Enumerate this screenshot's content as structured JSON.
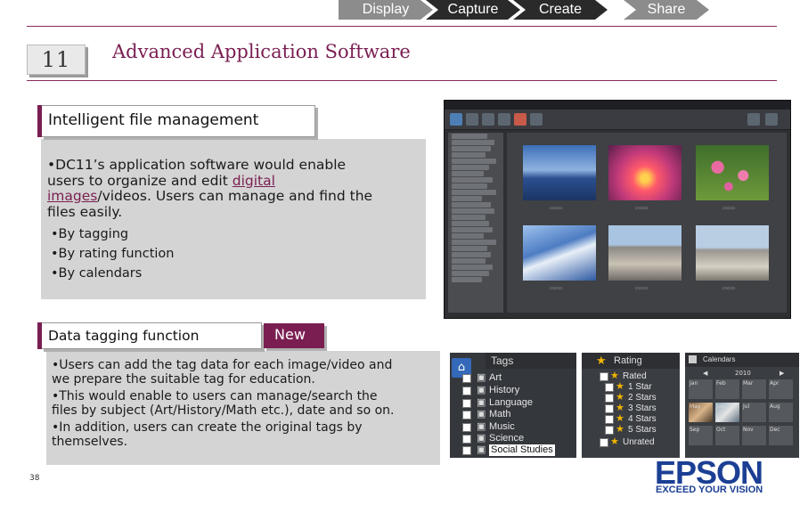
{
  "nav_steps": [
    "Display",
    "Capture",
    "Create",
    "Share"
  ],
  "chapter": {
    "number": "11",
    "title": "Advanced Application Software"
  },
  "section1": {
    "label": "Intelligent file management",
    "lines": [
      "•DC11’s application software would enable",
      "users to organize and edit "
    ],
    "link1": "digital",
    "link2": "images",
    "line_after_link": "/videos. Users can manage and find the",
    "last_line": "files easily.",
    "bullets": [
      "•By tagging",
      "•By rating function",
      "•By calendars"
    ]
  },
  "section2": {
    "label": "Data tagging function",
    "badge": "New",
    "para1": [
      "•Users can add the tag data for each image/video and",
      "we prepare the suitable tag for education."
    ],
    "para2": [
      "•This would enable to users can manage/search the",
      "files by subject (Art/History/Math etc.), date and so on."
    ],
    "para3": [
      "•In addition, users can create the original tags by",
      "themselves."
    ]
  },
  "tags_panel": {
    "title": "Tags",
    "items": [
      "Art",
      "History",
      "Language",
      "Math",
      "Music",
      "Science",
      "Social Studies"
    ]
  },
  "rating_panel": {
    "title": "Rating",
    "items": [
      "Rated",
      "1 Star",
      "2 Stars",
      "3 Stars",
      "4 Stars",
      "5 Stars",
      "Unrated"
    ]
  },
  "calendar_panel": {
    "title": "Calendars",
    "year": "2010",
    "months": [
      "Jan",
      "Feb",
      "Mar",
      "Apr",
      "May",
      "Jun",
      "Jul",
      "Aug",
      "Sep",
      "Oct",
      "Nov",
      "Dec"
    ]
  },
  "logo": {
    "brand": "EPSON",
    "tagline": "EXCEED YOUR VISION"
  },
  "page_number": "38",
  "colors": {
    "accent": "#7a1e52",
    "step": "#8c8c8c",
    "brand": "#1b3f94"
  }
}
